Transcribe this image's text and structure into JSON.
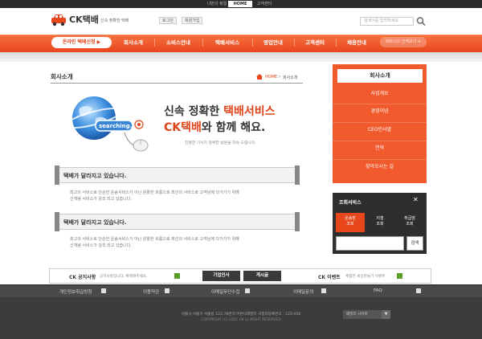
{
  "top": {
    "links": [
      "나만의 화일",
      "HOME",
      "고객센터"
    ]
  },
  "header": {
    "logo_text": "CK택배",
    "tagline": "신속 정확한 택배",
    "login": "로그인",
    "join": "회원가입",
    "search_placeholder": "검색어를 입력하세요"
  },
  "nav": {
    "pill": "온라인 택배신청",
    "items": [
      "회사소개",
      "소비스안내",
      "택배서비스",
      "영업안내",
      "고객센터",
      "채용안내"
    ],
    "partner": "파트너즈 인맥보기 +"
  },
  "main": {
    "page_title": "회사소개",
    "breadcrumb_home": "HOME",
    "breadcrumb_sep": ">",
    "breadcrumb_current": "회사소개",
    "globe_label": "searching...",
    "hero_line1_prefix": "신속 정확한 ",
    "hero_line1_red": "택배서비스",
    "hero_line2_red": "CK택배",
    "hero_line2_suffix": "와 함께 해요.",
    "hero_sub": "친절한 기사가 정확한 방문을 약속 드립니다.",
    "sections": [
      {
        "title": "택배가 달라지고 있습니다.",
        "body1": "최고의 서비스로 단순한 운송서비스가 아닌 원활한 흐름으로 최선의 서비스로 고객님께 다가가기 위해",
        "body2": "신개념 서비스가 강조 되고 있습니다."
      },
      {
        "title": "택배가 달라지고 있습니다.",
        "body1": "최고의 서비스로 단순한 운송서비스가 아닌 원활한 흐름으로 최선의 서비스로 고객님께 다가가기 위해",
        "body2": "신개념 서비스가 강조 되고 있습니다."
      }
    ]
  },
  "sidebar": {
    "title": "회사소개",
    "items": [
      "사업개요",
      "경영이념",
      "CEO인사말",
      "연혁",
      "찾아오시는 길"
    ]
  },
  "tracking": {
    "title": "조회서비스",
    "close": "✕",
    "tabs": [
      {
        "line1": "운송장",
        "line2": "조회"
      },
      {
        "line1": "지점",
        "line2": "조회"
      },
      {
        "line1": "취급점",
        "line2": "조회"
      }
    ],
    "button": "검색"
  },
  "notice": {
    "label": "CK 공지사항",
    "text": "공지사항입니다. 확제해주세요.",
    "btn1": "기업인사",
    "btn2": "게시글",
    "event_label": "CK 이벤트",
    "event_text": "체험한 세상만들기 이벤트"
  },
  "footer": {
    "links": [
      "개인정보취급방침",
      "이용약관",
      "이메일무단수집",
      "이메일문의",
      "FAQ"
    ],
    "address": "서울시 서울구 서울동 123-78번지 어반나래텐터 사업자등록번호 : 123-456",
    "copyright": "COPYRIGHT (C) 2011 CK LL RIGHT RESERVED",
    "family_site": "패밀리 사이트",
    "family_arrow": "▼"
  },
  "colors": {
    "accent": "#e8461b",
    "dark": "#3c3c3c"
  }
}
